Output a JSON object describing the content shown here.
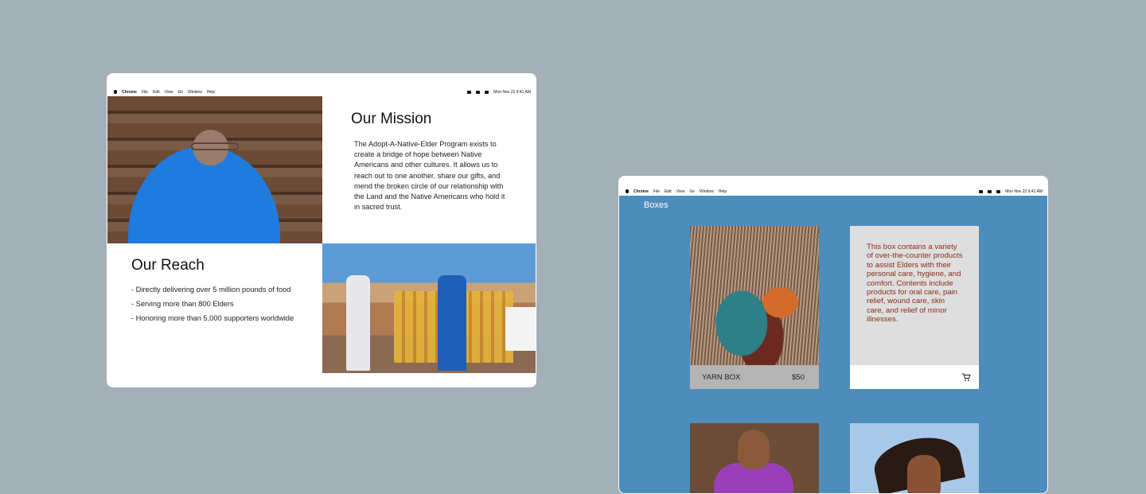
{
  "menubar": {
    "app": "Chrome",
    "items": [
      "File",
      "Edit",
      "View",
      "Go",
      "Window",
      "Help"
    ],
    "clock": "Mon Nov 22  9:41 AM"
  },
  "mission": {
    "title": "Our Mission",
    "body": "The Adopt-A-Native-Elder Program exists to create a bridge of hope between Native Americans and other cultures. It allows us to reach out to one another, share our gifts, and mend the broken circle of our relationship with the Land and the Native Americans who hold it in sacred trust."
  },
  "reach": {
    "title": "Our Reach",
    "items": [
      "- Directly delivering over 5 million  pounds of food",
      "- Serving more than 800 Elders",
      "- Honoring more than 5,000 supporters worldwide"
    ]
  },
  "boxes": {
    "title": "Boxes",
    "cards": [
      {
        "name": "YARN BOX",
        "price": "$50"
      },
      {
        "description": "This box contains a variety of over-the-counter products to assist Elders with their personal care, hygiene, and comfort. Contents include products for oral care, pain relief, wound care, skin care, and relief of minor illnesses."
      }
    ]
  }
}
